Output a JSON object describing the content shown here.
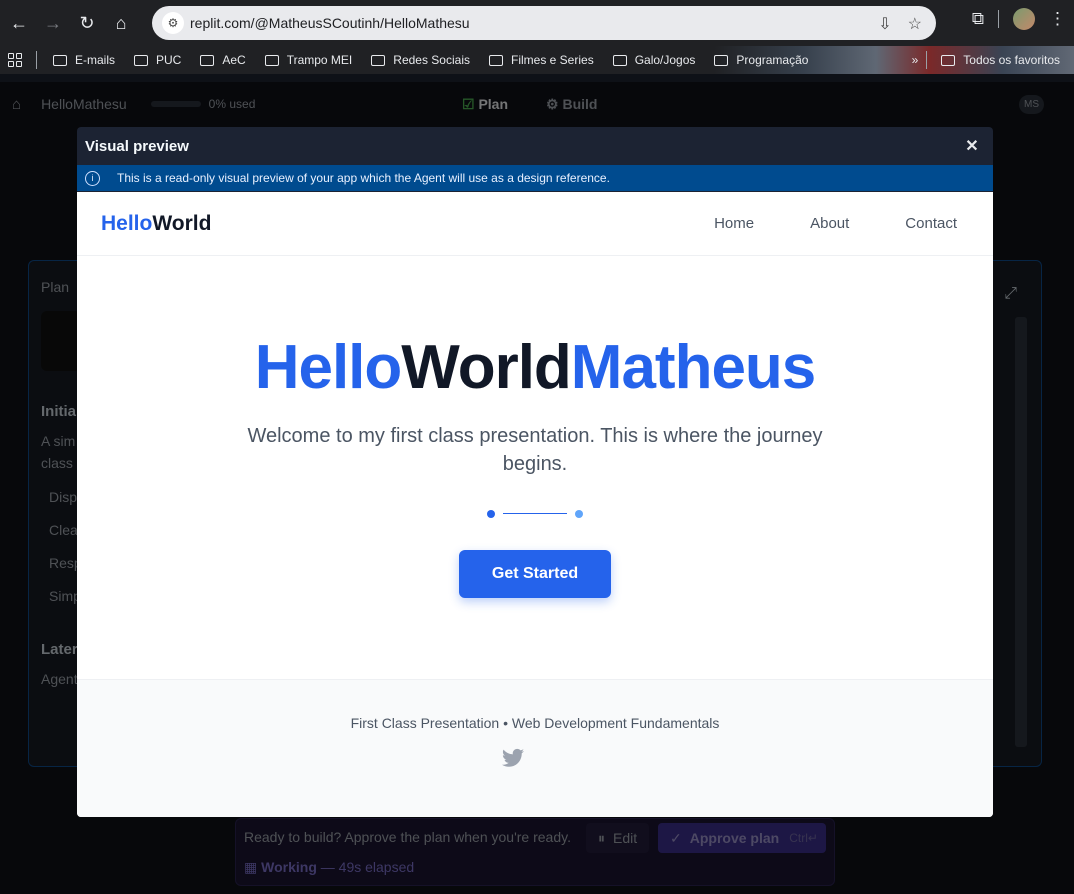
{
  "browser": {
    "url": "replit.com/@MatheusSCoutinh/HelloMathesu",
    "bookmarks": [
      "E-mails",
      "PUC",
      "AeC",
      "Trampo MEI",
      "Redes Sociais",
      "Filmes e Series",
      "Galo/Jogos",
      "Programação"
    ],
    "all_bookmarks": "Todos os favoritos"
  },
  "replit": {
    "project_name": "HelloMathesu",
    "usage": "0% used",
    "mode_plan": "Plan",
    "mode_build": "Build",
    "user_initials": "MS",
    "panel_label": "Plan",
    "ready_text": "Ready to build? Approve the plan when you're ready.",
    "edit_label": "Edit",
    "approve_label": "Approve plan",
    "approve_shortcut": "Ctrl↵",
    "working_label": "Working",
    "elapsed": "— 49s elapsed",
    "bg_heading_1": "Initia",
    "bg_text_1": "A sim",
    "bg_text_2": "class",
    "bg_items": [
      "Disp",
      "Clea",
      "Resp",
      "Simp"
    ],
    "bg_heading_2": "Later",
    "bg_text_3": "Agent"
  },
  "modal": {
    "title": "Visual preview",
    "banner": "This is a read-only visual preview of your app which the Agent will use as a design reference."
  },
  "site": {
    "logo_a": "Hello",
    "logo_b": "World",
    "nav": [
      "Home",
      "About",
      "Contact"
    ],
    "hero_a": "Hello",
    "hero_b": "World",
    "hero_c": "Matheus",
    "subtitle": "Welcome to my first class presentation. This is where the journey begins.",
    "cta": "Get Started",
    "footer": "First Class Presentation • Web Development Fundamentals"
  },
  "colors": {
    "accent": "#2563eb",
    "banner": "#004b8f",
    "modal_header": "#1c2333"
  }
}
